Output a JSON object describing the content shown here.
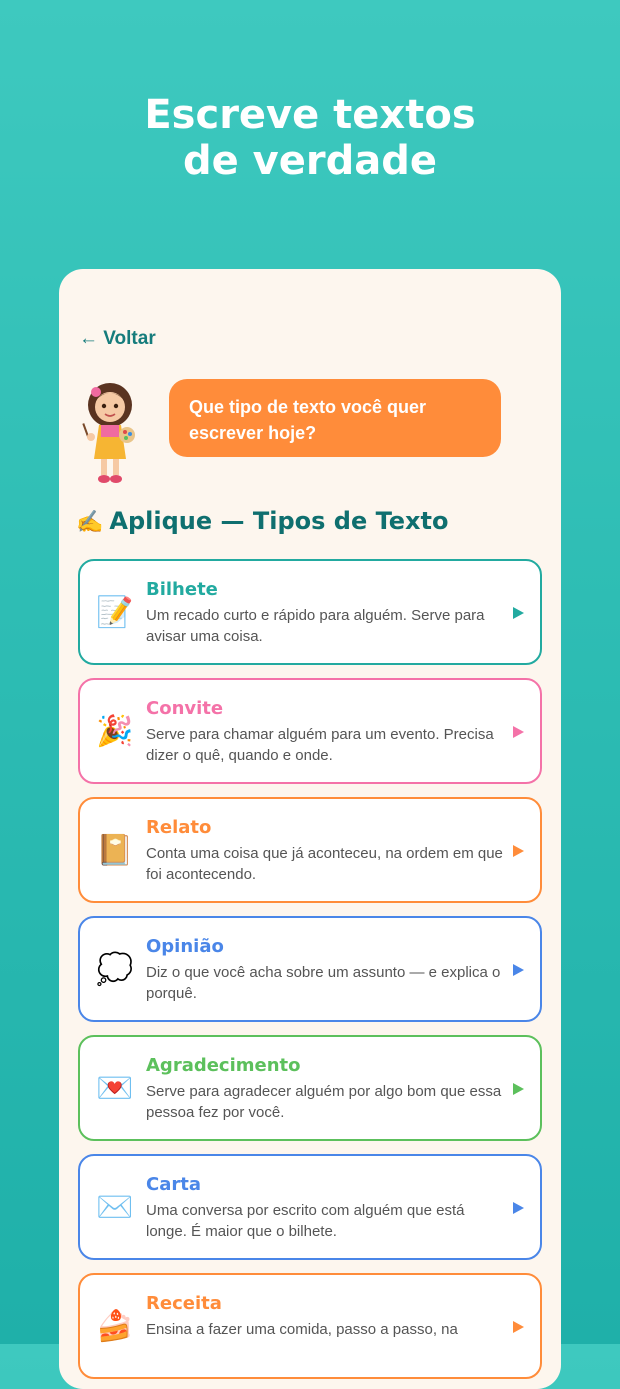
{
  "headline": {
    "line1": "Escreve textos",
    "line2": "de verdade"
  },
  "nav": {
    "back_label": "← Voltar"
  },
  "prompt": {
    "text": "Que tipo de texto você quer escrever hoje?"
  },
  "section": {
    "emoji": "✍️",
    "title": "Aplique — Tipos de Texto"
  },
  "colors": {
    "background": "#2ebdb4",
    "card": "#fdf6ee",
    "bubble": "#ff8c3a",
    "back_link": "#167c7c"
  },
  "text_types": [
    {
      "title": "Bilhete",
      "description": "Um recado curto e rápido para alguém. Serve para avisar uma coisa.",
      "icon": "📝",
      "icon_name": "memo-icon",
      "color": "#22aaa0"
    },
    {
      "title": "Convite",
      "description": "Serve para chamar alguém para um evento. Precisa dizer o quê, quando e onde.",
      "icon": "🎉",
      "icon_name": "party-popper-icon",
      "color": "#f472a8"
    },
    {
      "title": "Relato",
      "description": "Conta uma coisa que já aconteceu, na ordem em que foi acontecendo.",
      "icon": "📔",
      "icon_name": "notebook-icon",
      "color": "#ff8c3a"
    },
    {
      "title": "Opinião",
      "description": "Diz o que você acha sobre um assunto — e explica o porquê.",
      "icon": "💭",
      "icon_name": "thought-bubble-icon",
      "color": "#4a86e8"
    },
    {
      "title": "Agradecimento",
      "description": "Serve para agradecer alguém por algo bom que essa pessoa fez por você.",
      "icon": "💌",
      "icon_name": "love-letter-icon",
      "color": "#5cc05c"
    },
    {
      "title": "Carta",
      "description": "Uma conversa por escrito com alguém que está longe. É maior que o bilhete.",
      "icon": "✉️",
      "icon_name": "envelope-icon",
      "color": "#4a86e8"
    },
    {
      "title": "Receita",
      "description": "Ensina a fazer uma comida, passo a passo, na",
      "icon": "🍰",
      "icon_name": "cake-icon",
      "color": "#ff8c3a"
    }
  ]
}
